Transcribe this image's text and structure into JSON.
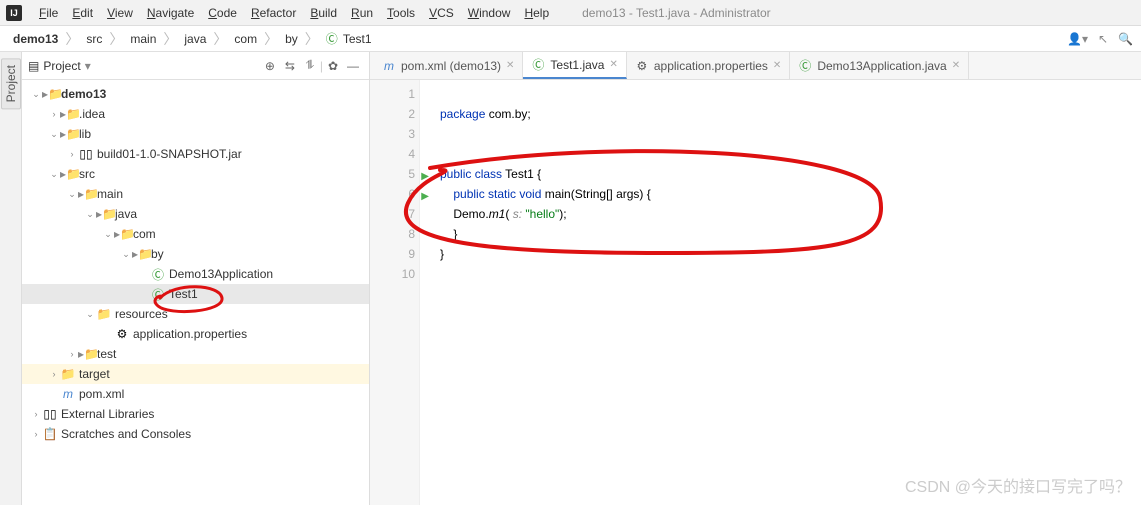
{
  "menu": [
    "File",
    "Edit",
    "View",
    "Navigate",
    "Code",
    "Refactor",
    "Build",
    "Run",
    "Tools",
    "VCS",
    "Window",
    "Help"
  ],
  "windowTitle": "demo13 - Test1.java - Administrator",
  "breadcrumbs": [
    "demo13",
    "src",
    "main",
    "java",
    "com",
    "by",
    "Test1"
  ],
  "gutterTab": "Project",
  "projectPanel": {
    "label": "Project"
  },
  "tree": [
    {
      "depth": 0,
      "toggle": "v",
      "ico": "folder",
      "label": "demo13",
      "bold": true
    },
    {
      "depth": 1,
      "toggle": ">",
      "ico": "folder",
      "label": ".idea"
    },
    {
      "depth": 1,
      "toggle": "v",
      "ico": "folder",
      "label": "lib"
    },
    {
      "depth": 2,
      "toggle": ">",
      "ico": "jar",
      "label": "build01-1.0-SNAPSHOT.jar"
    },
    {
      "depth": 1,
      "toggle": "v",
      "ico": "folder",
      "label": "src"
    },
    {
      "depth": 2,
      "toggle": "v",
      "ico": "folder",
      "label": "main"
    },
    {
      "depth": 3,
      "toggle": "v",
      "ico": "folder",
      "label": "java"
    },
    {
      "depth": 4,
      "toggle": "v",
      "ico": "folder",
      "label": "com"
    },
    {
      "depth": 5,
      "toggle": "v",
      "ico": "folder",
      "label": "by"
    },
    {
      "depth": 6,
      "toggle": "",
      "ico": "class",
      "label": "Demo13Application"
    },
    {
      "depth": 6,
      "toggle": "",
      "ico": "class",
      "label": "Test1",
      "sel": true
    },
    {
      "depth": 3,
      "toggle": "v",
      "ico": "res",
      "label": "resources"
    },
    {
      "depth": 4,
      "toggle": "",
      "ico": "props",
      "label": "application.properties"
    },
    {
      "depth": 2,
      "toggle": ">",
      "ico": "folder",
      "label": "test"
    },
    {
      "depth": 1,
      "toggle": ">",
      "ico": "folder-o",
      "label": "target",
      "hl": true
    },
    {
      "depth": 1,
      "toggle": "",
      "ico": "maven",
      "label": "pom.xml"
    },
    {
      "depth": 0,
      "toggle": ">",
      "ico": "lib",
      "label": "External Libraries"
    },
    {
      "depth": 0,
      "toggle": ">",
      "ico": "scratch",
      "label": "Scratches and Consoles"
    }
  ],
  "tabs": [
    {
      "ico": "maven",
      "label": "pom.xml (demo13)",
      "active": false
    },
    {
      "ico": "class",
      "label": "Test1.java",
      "active": true
    },
    {
      "ico": "props",
      "label": "application.properties",
      "active": false
    },
    {
      "ico": "class",
      "label": "Demo13Application.java",
      "active": false
    }
  ],
  "code": {
    "lines": [
      {
        "n": 1,
        "html": ""
      },
      {
        "n": 2,
        "html": "<span class='kw'>package</span> <span class='pkg'>com.by</span>;"
      },
      {
        "n": 3,
        "html": ""
      },
      {
        "n": 4,
        "html": ""
      },
      {
        "n": 5,
        "html": "<span class='kw'>public class</span> <span class='cls'>Test1</span> {",
        "run": true
      },
      {
        "n": 6,
        "html": "    <span class='kw'>public static void</span> main(String[] args) {",
        "run": true
      },
      {
        "n": 7,
        "html": "    Demo.<i>m1</i>( <span class='param'>s:</span> <span class='str'>\"hello\"</span>);"
      },
      {
        "n": 8,
        "html": "    }"
      },
      {
        "n": 9,
        "html": "}"
      },
      {
        "n": 10,
        "html": ""
      }
    ]
  },
  "watermark": "CSDN @今天的接口写完了吗？"
}
